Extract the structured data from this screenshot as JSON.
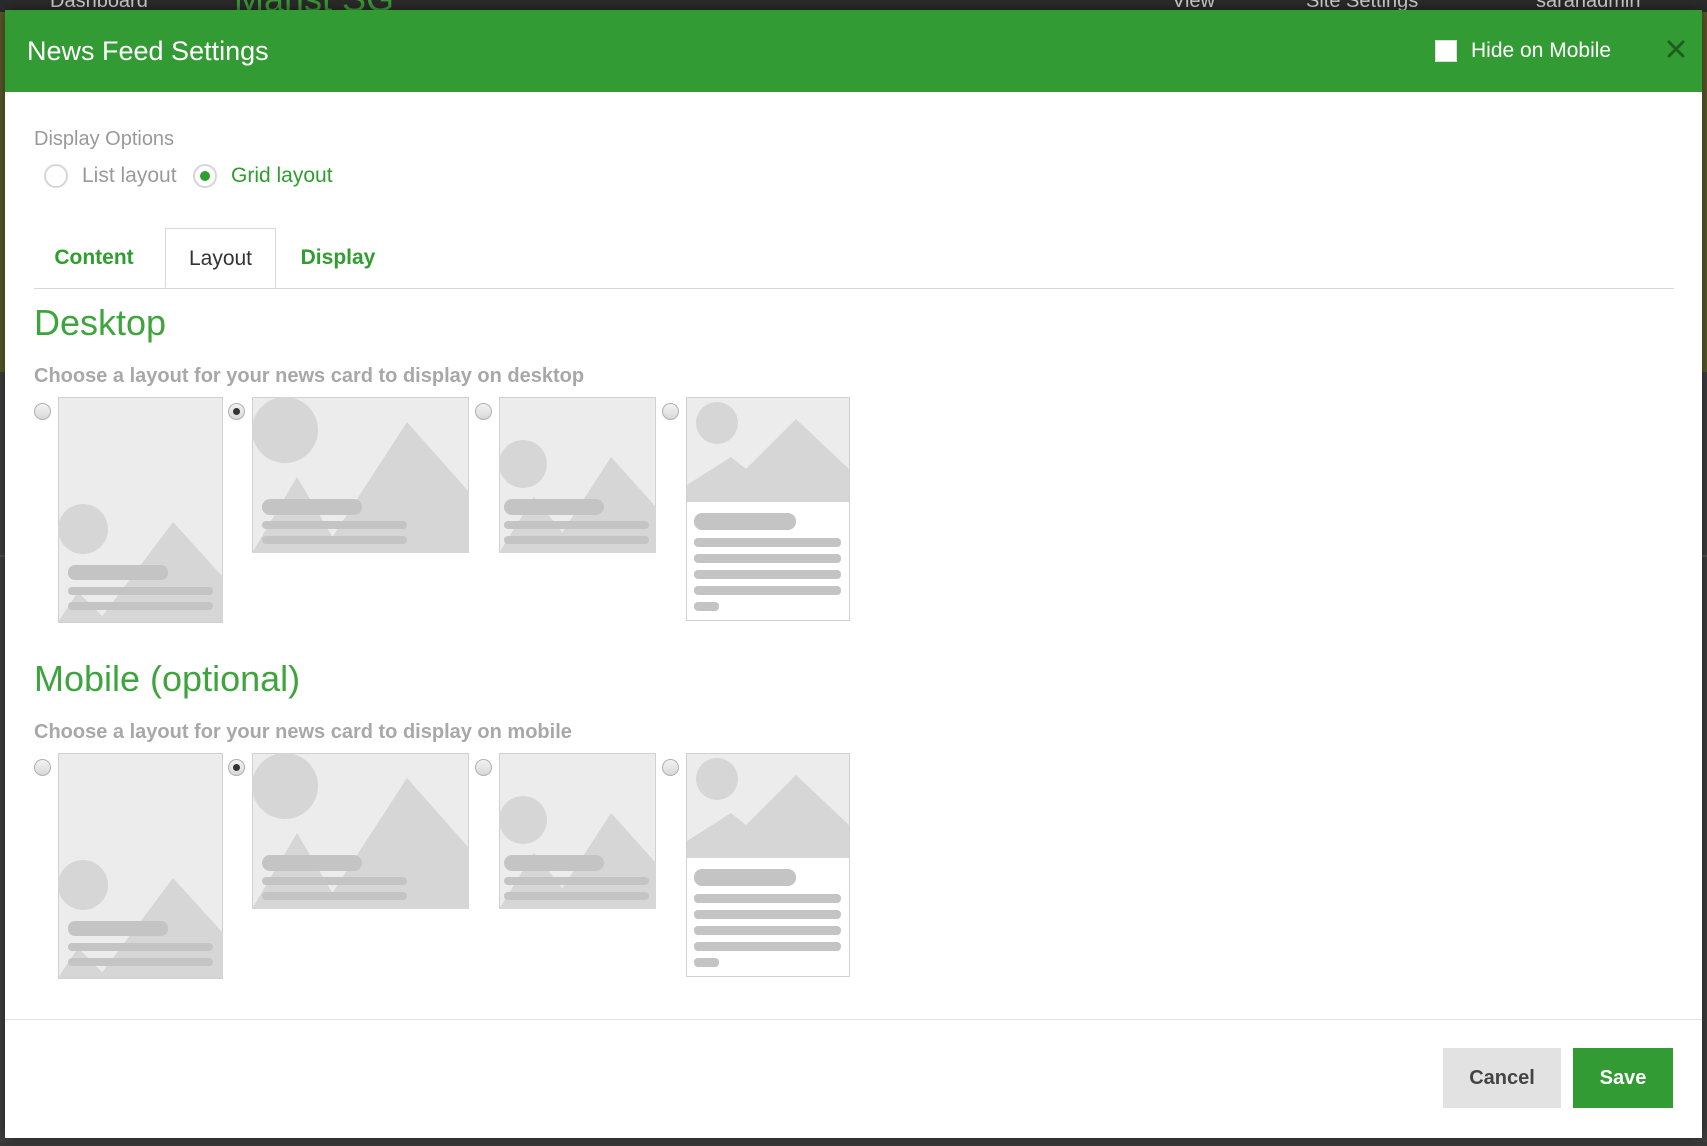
{
  "background": {
    "nav_items": [
      "Dashboard",
      "View",
      "Site Settings",
      "sarahadmin"
    ],
    "logo": "Marist SG"
  },
  "modal": {
    "title": "News Feed Settings",
    "hide_on_mobile": {
      "label": "Hide on Mobile",
      "checked": false
    },
    "close_icon": "close-icon"
  },
  "display_options": {
    "label": "Display Options",
    "options": [
      {
        "label": "List layout",
        "selected": false
      },
      {
        "label": "Grid layout",
        "selected": true
      }
    ]
  },
  "tabs": [
    {
      "label": "Content",
      "active": false
    },
    {
      "label": "Layout",
      "active": true
    },
    {
      "label": "Display",
      "active": false
    }
  ],
  "desktop": {
    "heading": "Desktop",
    "subtext": "Choose a layout for your news card to display on desktop",
    "selected_index": 1
  },
  "mobile": {
    "heading": "Mobile (optional)",
    "subtext": "Choose a layout for your news card to display on mobile",
    "selected_index": 1
  },
  "footer": {
    "cancel_label": "Cancel",
    "save_label": "Save"
  },
  "colors": {
    "accent": "#339b33",
    "accent_text": "#2f9e2f",
    "muted_text": "#a8a8a8"
  }
}
